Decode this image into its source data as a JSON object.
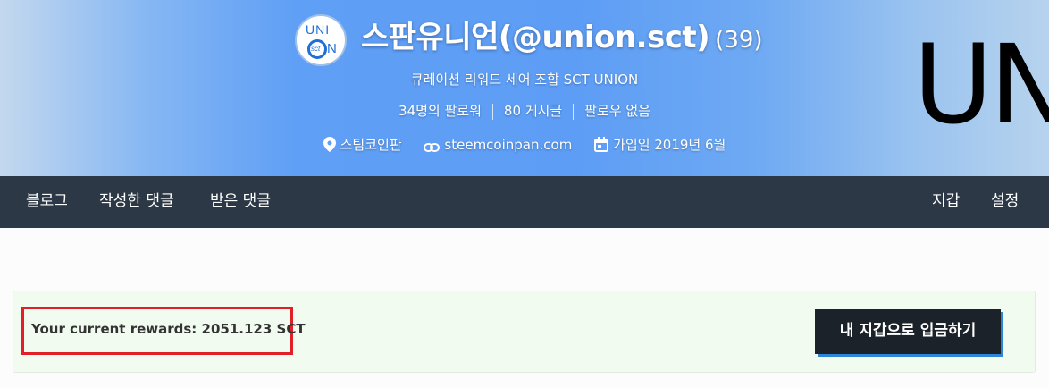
{
  "header": {
    "background_word": "UNI",
    "logo": {
      "line1": "UNI",
      "line2_badge": "sct",
      "line2_letter": "N"
    },
    "display_name": "스판유니언(@union.sct)",
    "reputation": "(39)",
    "tagline": "큐레이션 리워드 세어 조합 SCT UNION",
    "stats": {
      "followers": "34명의 팔로워",
      "posts": "80 게시글",
      "following": "팔로우 없음"
    },
    "meta": {
      "location": "스팀코인판",
      "website": "steemcoinpan.com",
      "joined": "가입일 2019년 6월",
      "location_icon": "map-pin-icon",
      "website_icon": "link-icon",
      "joined_icon": "calendar-icon"
    },
    "colors": {
      "gradient_mid": "#5d9df5",
      "gradient_edge": "#c3d8ee"
    }
  },
  "nav": {
    "left": [
      "블로그",
      "작성한 댓글",
      "받은 댓글"
    ],
    "right": [
      "지갑",
      "설정"
    ],
    "background": "#2c3845"
  },
  "wallet": {
    "rewards_text": "Your current rewards: 2051.123 SCT",
    "deposit_button": "내 지갑으로 입금하기",
    "highlight_color": "#e01f26",
    "button_accent": "#2f86d6"
  }
}
